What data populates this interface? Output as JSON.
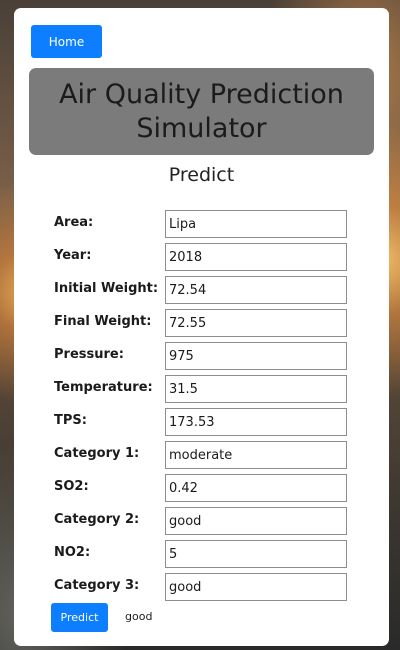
{
  "nav": {
    "home_label": "Home"
  },
  "header": {
    "title": "Air Quality Prediction Simulator"
  },
  "form": {
    "heading": "Predict",
    "fields": [
      {
        "label": "Area:",
        "value": "Lipa"
      },
      {
        "label": "Year:",
        "value": "2018"
      },
      {
        "label": "Initial Weight:",
        "value": "72.54"
      },
      {
        "label": "Final Weight:",
        "value": "72.55"
      },
      {
        "label": "Pressure:",
        "value": "975"
      },
      {
        "label": "Temperature:",
        "value": "31.5"
      },
      {
        "label": "TPS:",
        "value": "173.53"
      },
      {
        "label": "Category 1:",
        "value": "moderate"
      },
      {
        "label": "SO2:",
        "value": "0.42"
      },
      {
        "label": "Category 2:",
        "value": "good"
      },
      {
        "label": "NO2:",
        "value": "5"
      },
      {
        "label": "Category 3:",
        "value": "good"
      }
    ],
    "predict_label": "Predict",
    "result": "good"
  }
}
